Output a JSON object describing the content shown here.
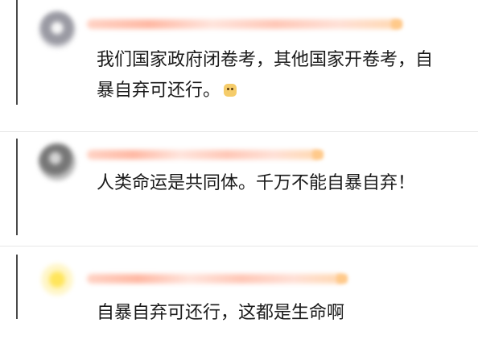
{
  "comments": [
    {
      "text": "我们国家政府闭卷考，其他国家开卷考，自暴自弃可还行。",
      "emoji": "doge-emoji"
    },
    {
      "text": "人类命运是共同体。千万不能自暴自弃！"
    },
    {
      "text": "自暴自弃可还行，这都是生命啊"
    }
  ],
  "colors": {
    "divider": "#e6e6e6",
    "username_blur": "#ffb8a3",
    "text": "#1a1a1a"
  }
}
